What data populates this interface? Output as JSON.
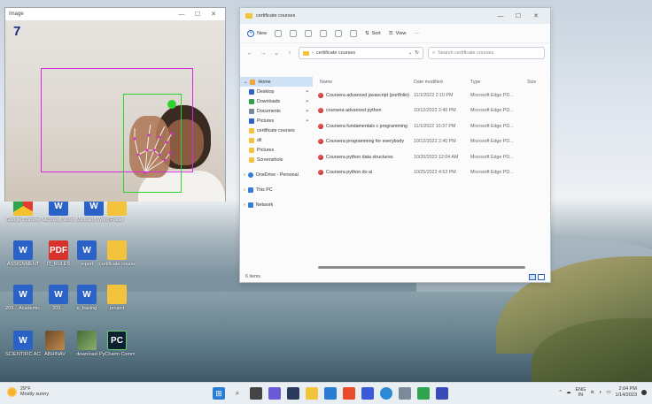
{
  "webcam_window": {
    "title": "Image",
    "finger_count": "7"
  },
  "desktop_icons": [
    {
      "label": "Google Chrome",
      "type": "chrome"
    },
    {
      "label": "Microsoft Word",
      "type": "word"
    },
    {
      "label": "Microsoft Word 2",
      "type": "word"
    },
    {
      "label": "Folder",
      "type": "folder"
    },
    {
      "label": "ASSIGNMENT",
      "type": "word"
    },
    {
      "label": "IT_RULES",
      "type": "pdf"
    },
    {
      "label": "report",
      "type": "word"
    },
    {
      "label": "certificate courses",
      "type": "folder"
    },
    {
      "label": "209... Academic...",
      "type": "word"
    },
    {
      "label": "209...",
      "type": "word"
    },
    {
      "label": "e_tracing",
      "type": "word"
    },
    {
      "label": "project",
      "type": "folder"
    },
    {
      "label": "SCIENTIFIC ACHIEVEMENTS",
      "type": "word"
    },
    {
      "label": "ABHINAV",
      "type": "image"
    },
    {
      "label": "download",
      "type": "image2"
    },
    {
      "label": "PyCharm Community",
      "type": "pycharm"
    }
  ],
  "explorer": {
    "tab_title": "certificate courses",
    "toolbar": {
      "new_label": "New",
      "sort_label": "Sort",
      "view_label": "View",
      "more_label": "···"
    },
    "address": "certificate courses",
    "search_placeholder": "Search certificate courses",
    "nav": {
      "home": "Home",
      "items": [
        {
          "label": "Desktop",
          "color": "#2b62c8"
        },
        {
          "label": "Downloads",
          "color": "#2ea44f"
        },
        {
          "label": "Documents",
          "color": "#7a8a9a"
        },
        {
          "label": "Pictures",
          "color": "#2b62c8"
        },
        {
          "label": "certificate courses",
          "color": "#f2c33b"
        },
        {
          "label": "dil",
          "color": "#f2c33b"
        },
        {
          "label": "Pictures",
          "color": "#f2c33b"
        },
        {
          "label": "Screenshots",
          "color": "#f2c33b"
        }
      ],
      "onedrive": "OneDrive - Personal",
      "thispc": "This PC",
      "network": "Network"
    },
    "columns": {
      "name": "Name",
      "date": "Date modified",
      "type": "Type",
      "size": "Size"
    },
    "files": [
      {
        "name": "Coursera advanced javascript (portfolio)",
        "date": "11/1/2022 2:10 PM",
        "type": "Microsoft Edge PD..."
      },
      {
        "name": "coursera advanced python",
        "date": "10/12/2022 2:40 PM",
        "type": "Microsoft Edge PD..."
      },
      {
        "name": "Coursera fundamentals c programming",
        "date": "11/1/2022 10:37 PM",
        "type": "Microsoft Edge PD..."
      },
      {
        "name": "Coursera programming for everybody",
        "date": "10/12/2022 2:40 PM",
        "type": "Microsoft Edge PD..."
      },
      {
        "name": "Coursera python data structures",
        "date": "10/20/2022 12:04 AM",
        "type": "Microsoft Edge PD..."
      },
      {
        "name": "Coursera python do ai",
        "date": "10/25/2022 4:53 PM",
        "type": "Microsoft Edge PD..."
      }
    ],
    "status": "6 items"
  },
  "taskbar": {
    "weather_temp": "29°F",
    "weather_desc": "Mostly sunny",
    "lang": "ENG",
    "region": "IN",
    "time": "2:04 PM",
    "date": "1/14/2023"
  }
}
